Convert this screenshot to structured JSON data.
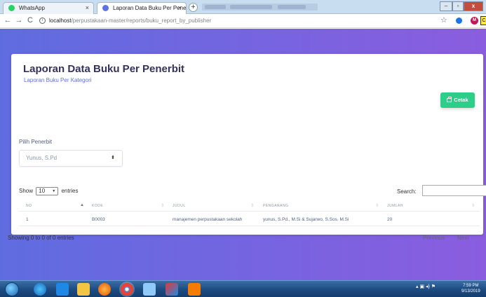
{
  "browser": {
    "tabs": [
      {
        "title": "WhatsApp",
        "active": false,
        "icon_color": "#25d366"
      },
      {
        "title": "Laporan Data Buku Per Penerbit",
        "active": true,
        "icon_color": "#5e72e4"
      }
    ],
    "new_tab_glyph": "+",
    "close_glyph": "×",
    "url_host": "localhost",
    "url_path": "/perpustakaan-master/reports/buku_report_by_publisher",
    "info_glyph": "i",
    "nav": {
      "back": "←",
      "forward": "→",
      "reload": "C"
    },
    "star_glyph": "☆",
    "ext2_label": "M",
    "ext3_label": "C",
    "window": {
      "minimize": "–",
      "maximize": "▫",
      "close": "x"
    }
  },
  "page": {
    "title": "Laporan Data Buku Per Penerbit",
    "subtitle": "Laporan Buku Per Kategori",
    "print_button": "Cetak",
    "publisher_label": "Pilih Penerbit",
    "publisher_selected": "Yunus, S.Pd",
    "select_arrow": "⬍",
    "show_prefix": "Show",
    "show_value": "10",
    "show_suffix": "entries",
    "search_label": "Search:",
    "search_value": "",
    "columns": [
      "NO",
      "KODE",
      "JUDUL",
      "PENGARANG",
      "JUMLAH"
    ],
    "rows": [
      {
        "no": "1",
        "kode": "B0003",
        "judul": "manajemen perpustakaan sekolah",
        "pengarang": "yunus, S.Pd., M.Si & Sujarwo, S.Sos. M.Si",
        "jumlah": "20"
      }
    ],
    "info": "Showing 0 to 0 of 0 entries",
    "previous": "Previous",
    "next": "Next"
  },
  "taskbar": {
    "time": "7:59 PM",
    "date": "9/13/2019",
    "tray_glyphs": "▴ ▣ ◂) ⚑"
  },
  "colors": {
    "gradient_start": "#5f6ce0",
    "gradient_end": "#8a5ddf",
    "primary": "#5e72e4",
    "success": "#2dce89",
    "heading": "#32325d"
  }
}
